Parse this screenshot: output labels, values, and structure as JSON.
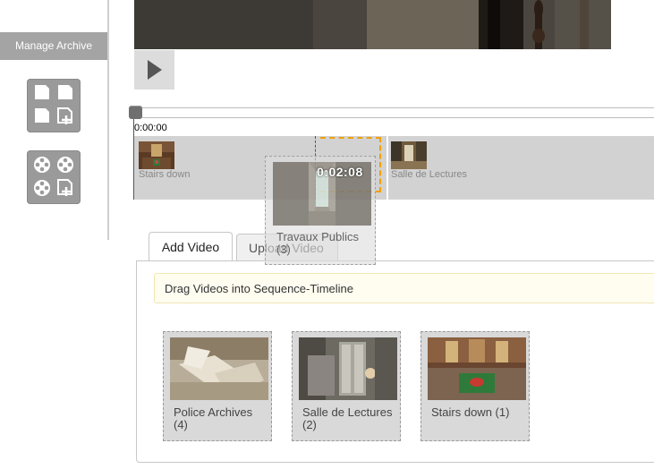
{
  "sidebar": {
    "manage_archive": "Manage Archive",
    "icons": [
      "documents-add-icon",
      "videos-add-icon"
    ]
  },
  "player": {
    "play_icon": "play-icon",
    "current_time": "0:00:00"
  },
  "timeline": {
    "clips": [
      {
        "label": "Stairs down"
      },
      {
        "label": "Salle de Lectures"
      }
    ],
    "drag_item": {
      "duration": "0:02:08",
      "title": "Travaux Publics (3)"
    }
  },
  "tabs": [
    {
      "label": "Add Video",
      "active": true
    },
    {
      "label": "Upload Video",
      "active": false
    }
  ],
  "panel": {
    "hint": "Drag Videos into Sequence-Timeline",
    "videos": [
      {
        "title": "Police Archives (4)"
      },
      {
        "title": "Salle de Lectures (2)"
      },
      {
        "title": "Stairs down (1)"
      }
    ]
  },
  "colors": {
    "highlight": "#f0a000",
    "sidebar_button": "#a4a4a4",
    "timeline": "#d2d2d2"
  }
}
